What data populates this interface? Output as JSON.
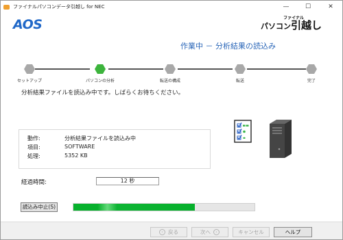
{
  "window": {
    "title": "ファイナルパソコンデータ引越し for NEC",
    "controls": {
      "minimize": "—",
      "maximize": "☐",
      "close": "✕"
    }
  },
  "header": {
    "logo": "AOS",
    "product_sub": "ファイナル",
    "product_main_a": "パソコン",
    "product_main_b": "引越し",
    "step_title": "作業中 － 分析結果の読込み"
  },
  "steps": [
    {
      "label": "セットアップ",
      "state": "done"
    },
    {
      "label": "パソコンの分析",
      "state": "active"
    },
    {
      "label": "転送の構成",
      "state": "pending"
    },
    {
      "label": "転送",
      "state": "pending"
    },
    {
      "label": "完了",
      "state": "pending"
    }
  ],
  "colors": {
    "active": "#3cb43c",
    "inactive": "#a8a8a8",
    "accent": "#2a66b8",
    "progress": "#06b02b"
  },
  "message": "分析結果ファイルを読込み中です。しばらくお待ちください。",
  "status": {
    "rows": [
      {
        "key": "動作:",
        "value": "分析結果ファイルを読込み中"
      },
      {
        "key": "項目:",
        "value": "SOFTWARE"
      },
      {
        "key": "処理:",
        "value": "5352 KB"
      }
    ]
  },
  "elapsed": {
    "label": "経過時間:",
    "value": "12 秒"
  },
  "abort_button": "読込み中止(S)",
  "progress": {
    "fraction": 0.67
  },
  "footer": {
    "back": "戻る",
    "next": "次へ",
    "cancel": "キャンセル",
    "help": "ヘルプ"
  }
}
